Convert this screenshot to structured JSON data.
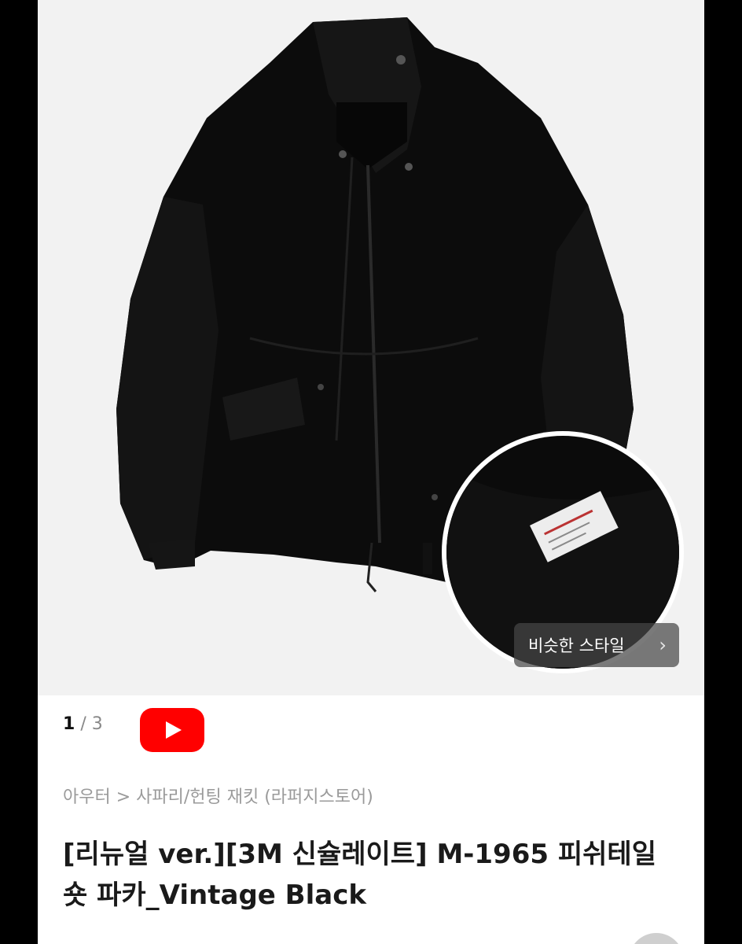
{
  "gallery": {
    "current_page": "1",
    "separator": "/",
    "total_pages": "3",
    "similar_style_label": "비슷한 스타일",
    "chevron_glyph": "›"
  },
  "video_button": {
    "icon": "youtube-play-icon",
    "color": "#ff0000"
  },
  "breadcrumb": {
    "path": "아우터 > 사파리/헌팅 재킷 (라퍼지스토어)"
  },
  "product": {
    "title": "[리뉴얼 ver.][3M 신슐레이트] M-1965 피쉬테일 숏 파카_Vintage Black"
  },
  "colors": {
    "hero_background": "#f2f2f2",
    "accent_red": "#ff0000"
  }
}
